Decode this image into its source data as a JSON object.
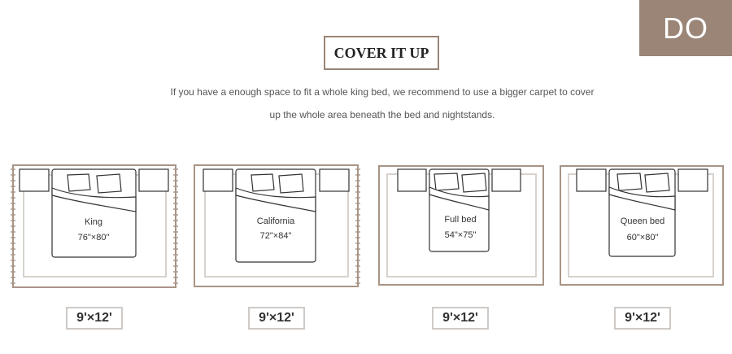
{
  "badge": {
    "label": "DO"
  },
  "header": {
    "title": "COVER IT UP",
    "description_line1": "If you have a enough space to fit a whole king bed, we recommend to use a bigger carpet to cover",
    "description_line2": "up the whole area beneath the bed and nightstands."
  },
  "cards": [
    {
      "bed_name": "King",
      "bed_size": "76\"×80\"",
      "rug_size": "9'×12'"
    },
    {
      "bed_name": "California",
      "bed_size": "72\"×84\"",
      "rug_size": "9'×12'"
    },
    {
      "bed_name": "Full bed",
      "bed_size": "54\"×75\"",
      "rug_size": "9'×12'"
    },
    {
      "bed_name": "Queen bed",
      "bed_size": "60\"×80\"",
      "rug_size": "9'×12'"
    }
  ],
  "colors": {
    "accent": "#9a8577",
    "rug_line": "#a89486",
    "inner_line": "#d8d2ce",
    "size_border": "#cfcac6"
  }
}
